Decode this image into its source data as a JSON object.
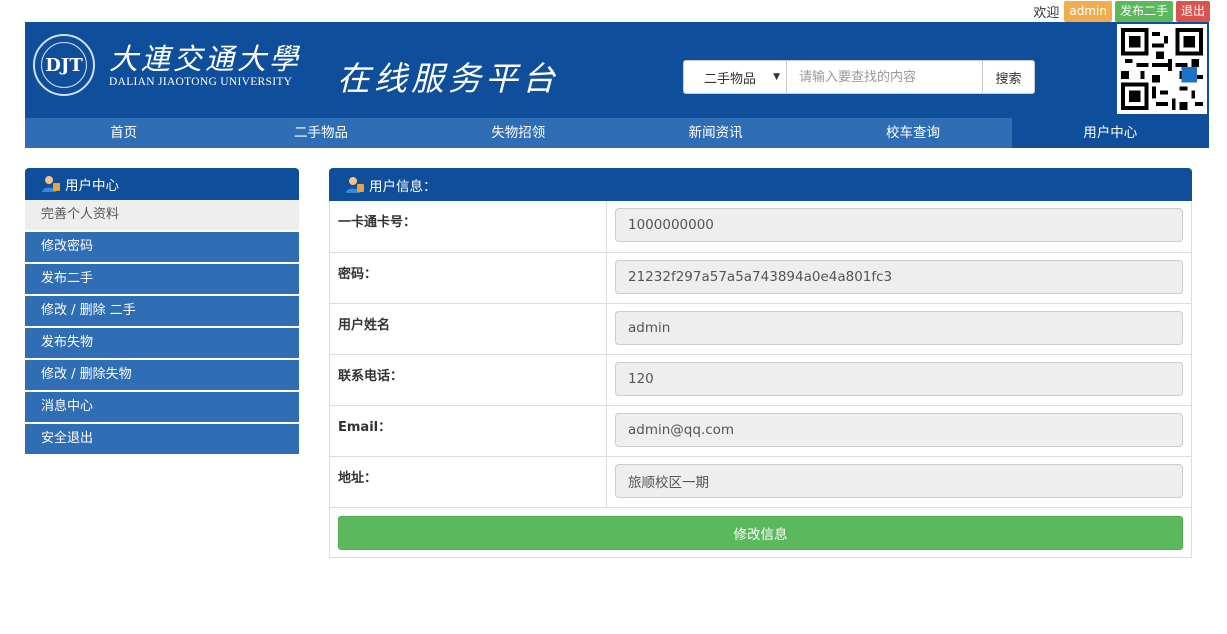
{
  "topbar": {
    "welcome": "欢迎",
    "username": "admin",
    "post_label": "发布二手",
    "logout_label": "退出"
  },
  "header": {
    "logo_cn": "大連交通大學",
    "logo_en": "DALIAN JIAOTONG UNIVERSITY",
    "logo_emblem_text": "DJT",
    "platform_title": "在线服务平台",
    "search_category": "二手物品",
    "search_placeholder": "请输入要查找的内容",
    "search_button": "搜索"
  },
  "nav": {
    "items": [
      "首页",
      "二手物品",
      "失物招领",
      "新闻资讯",
      "校车查询",
      "用户中心"
    ],
    "active_index": 5
  },
  "sidebar": {
    "title": "用户中心",
    "current": "完善个人资料",
    "items": [
      "修改密码",
      "发布二手",
      "修改 / 删除 二手",
      "发布失物",
      "修改 / 删除失物",
      "消息中心",
      "安全退出"
    ]
  },
  "panel": {
    "title": "用户信息：",
    "fields": [
      {
        "label": "一卡通卡号：",
        "value": "1000000000"
      },
      {
        "label": "密码：",
        "value": "21232f297a57a5a743894a0e4a801fc3"
      },
      {
        "label": "用户姓名",
        "value": "admin"
      },
      {
        "label": "联系电话：",
        "value": "120"
      },
      {
        "label": "Email：",
        "value": "admin@qq.com"
      },
      {
        "label": "地址：",
        "value": "旅顺校区一期"
      }
    ],
    "submit_label": "修改信息"
  },
  "colors": {
    "primary_dark": "#0f4e9b",
    "primary": "#2f6db5",
    "success": "#5cb85c",
    "warning": "#f0ad4e",
    "danger": "#d9534f"
  }
}
